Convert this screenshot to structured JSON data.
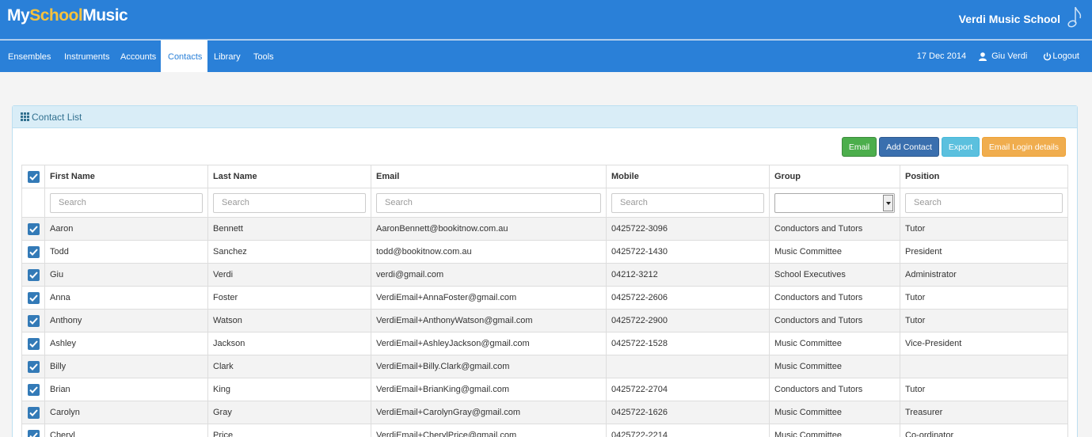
{
  "header": {
    "logo_my": "My",
    "logo_school": "School",
    "logo_music": "Music",
    "school_name": "Verdi Music School",
    "school_icon": "music-note-icon"
  },
  "nav": {
    "items": [
      {
        "label": "Ensembles"
      },
      {
        "label": "Instruments"
      },
      {
        "label": "Accounts"
      },
      {
        "label": "Contacts",
        "active": true
      },
      {
        "label": "Library"
      },
      {
        "label": "Tools"
      }
    ],
    "date": "17 Dec 2014",
    "user": "Giu Verdi",
    "logout": "Logout"
  },
  "panel": {
    "title": "Contact List",
    "title_icon": "grid-icon",
    "buttons": {
      "email": "Email",
      "add_contact": "Add Contact",
      "export": "Export",
      "email_login": "Email Login details"
    }
  },
  "table": {
    "columns": [
      "First Name",
      "Last Name",
      "Email",
      "Mobile",
      "Group",
      "Position"
    ],
    "search_placeholder": "Search",
    "group_filter_value": "",
    "rows": [
      [
        "Aaron",
        "Bennett",
        "AaronBennett@bookitnow.com.au",
        "0425722-3096",
        "Conductors and Tutors",
        "Tutor"
      ],
      [
        "Todd",
        "Sanchez",
        "todd@bookitnow.com.au",
        "0425722-1430",
        "Music Committee",
        "President"
      ],
      [
        "Giu",
        "Verdi",
        "verdi@gmail.com",
        "04212-3212",
        "School Executives",
        "Administrator"
      ],
      [
        "Anna",
        "Foster",
        "VerdiEmail+AnnaFoster@gmail.com",
        "0425722-2606",
        "Conductors and Tutors",
        "Tutor"
      ],
      [
        "Anthony",
        "Watson",
        "VerdiEmail+AnthonyWatson@gmail.com",
        "0425722-2900",
        "Conductors and Tutors",
        "Tutor"
      ],
      [
        "Ashley",
        "Jackson",
        "VerdiEmail+AshleyJackson@gmail.com",
        "0425722-1528",
        "Music Committee",
        "Vice-President"
      ],
      [
        "Billy",
        "Clark",
        "VerdiEmail+Billy.Clark@gmail.com",
        "",
        "Music Committee",
        ""
      ],
      [
        "Brian",
        "King",
        "VerdiEmail+BrianKing@gmail.com",
        "0425722-2704",
        "Conductors and Tutors",
        "Tutor"
      ],
      [
        "Carolyn",
        "Gray",
        "VerdiEmail+CarolynGray@gmail.com",
        "0425722-1626",
        "Music Committee",
        "Treasurer"
      ],
      [
        "Cheryl",
        "Price",
        "VerdiEmail+CherylPrice@gmail.com",
        "0425722-2214",
        "Music Committee",
        "Co-ordinator"
      ]
    ],
    "all_checked": true
  },
  "colors": {
    "brand_blue": "#2a80d8",
    "logo_accent": "#f7c23c",
    "checkbox_blue": "#337ab7",
    "panel_heading_bg": "#d9edf7"
  }
}
